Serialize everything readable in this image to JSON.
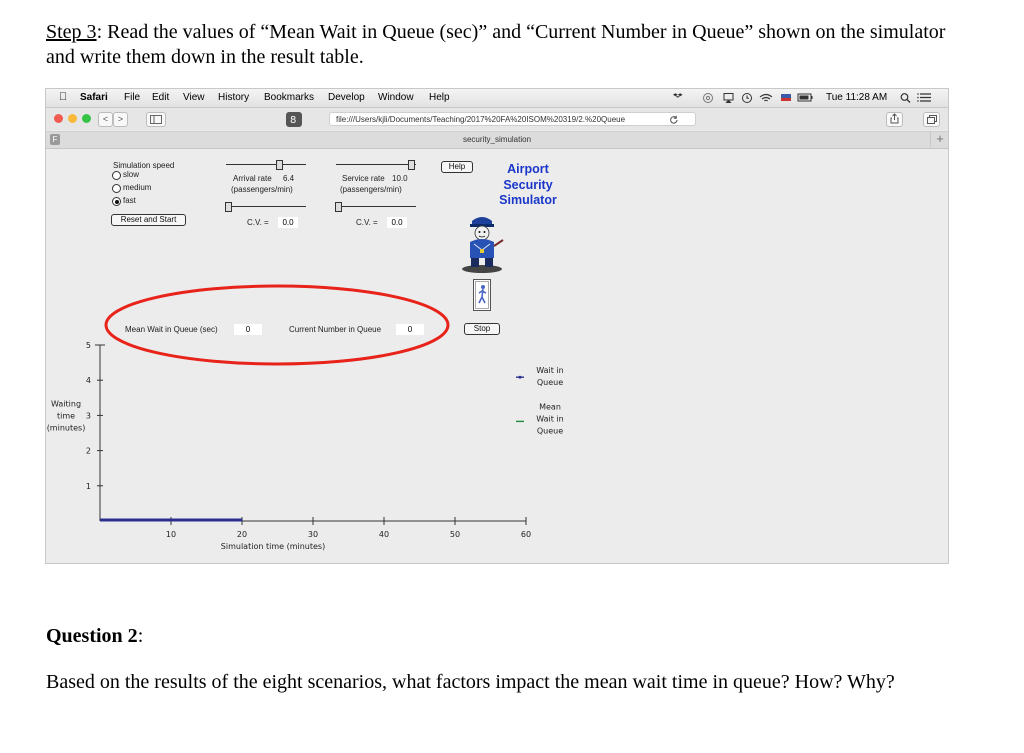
{
  "document": {
    "step_prefix": "Step 3",
    "step_text": ": Read the values of “Mean Wait in Queue (sec)” and “Current Number in Queue” shown on the simulator and write them down in the result table.",
    "question_heading": "Question 2",
    "question_colon": ":",
    "question_text": "Based on the results of the eight scenarios, what factors impact the mean wait time in queue? How? Why?"
  },
  "menubar": {
    "items": [
      "Safari",
      "File",
      "Edit",
      "View",
      "History",
      "Bookmarks",
      "Develop",
      "Window",
      "Help"
    ],
    "clock": "Tue 11:28 AM"
  },
  "toolbar": {
    "url": "file:///Users/kjli/Documents/Teaching/2017%20FA%20ISOM%20319/2.%20Queue",
    "back": "<",
    "forward": ">"
  },
  "tab": {
    "title": "security_simulation",
    "new_tab": "+",
    "left_badge": "F"
  },
  "simulator": {
    "speed_label": "Simulation speed",
    "speed_options": [
      "slow",
      "medium",
      "fast"
    ],
    "speed_selected": "fast",
    "reset_label": "Reset and Start",
    "arrival_label": "Arrival rate",
    "arrival_value": "6.4",
    "arrival_unit": "(passengers/min)",
    "service_label": "Service rate",
    "service_value": "10.0",
    "service_unit": "(passengers/min)",
    "cv_label": "C.V. =",
    "cv_arrival": "0.0",
    "cv_service": "0.0",
    "help_label": "Help",
    "title_line1": "Airport",
    "title_line2": "Security",
    "title_line3": "Simulator",
    "stop_label": "Stop",
    "mean_wait_label": "Mean Wait in Queue (sec)",
    "mean_wait_value": "0",
    "current_number_label": "Current Number in Queue",
    "current_number_value": "0",
    "colors": {
      "title": "#1a37c9",
      "annotation": "#e8231a",
      "series_queue": "#2a2f8f",
      "series_mean": "#1f8a3c"
    }
  },
  "chart_data": {
    "type": "line",
    "title": "",
    "xlabel": "Simulation time (minutes)",
    "ylabel": "Waiting time (minutes)",
    "ylabel_lines": [
      "Waiting",
      "time",
      "(minutes)"
    ],
    "xlim": [
      0,
      60
    ],
    "ylim": [
      0,
      5
    ],
    "xticks": [
      10,
      20,
      30,
      40,
      50,
      60
    ],
    "yticks": [
      1,
      2,
      3,
      4,
      5
    ],
    "grid": false,
    "legend_position": "right",
    "series": [
      {
        "name": "Wait in Queue",
        "name_lines": [
          "Wait in",
          "Queue"
        ],
        "color": "#2a2f8f",
        "x": [
          0,
          20
        ],
        "y": [
          0,
          0
        ]
      },
      {
        "name": "Mean Wait in Queue",
        "name_lines": [
          "Mean",
          "Wait in",
          "Queue"
        ],
        "color": "#1f8a3c",
        "x": [],
        "y": []
      }
    ]
  }
}
